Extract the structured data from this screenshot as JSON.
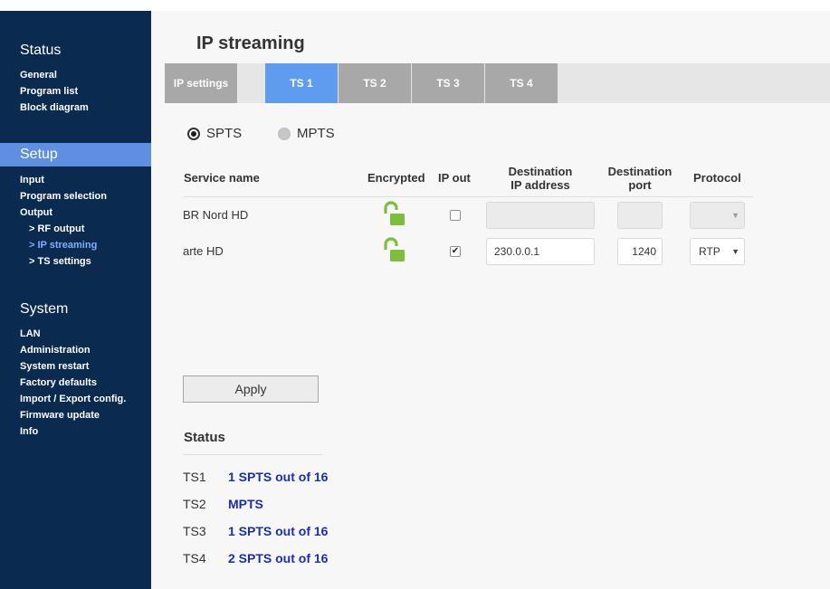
{
  "sidebar": {
    "status_title": "Status",
    "status_items": [
      "General",
      "Program list",
      "Block diagram"
    ],
    "setup_title": "Setup",
    "setup_items": [
      "Input",
      "Program selection",
      "Output",
      "> RF output",
      "> IP streaming",
      "> TS settings"
    ],
    "system_title": "System",
    "system_items": [
      "LAN",
      "Administration",
      "System restart",
      "Factory defaults",
      "Import / Export config.",
      "Firmware update",
      "Info"
    ]
  },
  "page": {
    "title": "IP streaming"
  },
  "tabs": [
    "IP settings",
    "TS 1",
    "TS 2",
    "TS 3",
    "TS 4"
  ],
  "active_tab": "TS 1",
  "mode": {
    "options": [
      "SPTS",
      "MPTS"
    ],
    "selected": "SPTS"
  },
  "table": {
    "headers": {
      "service": "Service name",
      "encrypted": "Encrypted",
      "ipout": "IP out",
      "dest_ip_1": "Destination",
      "dest_ip_2": "IP address",
      "dest_port_1": "Destination",
      "dest_port_2": "port",
      "protocol": "Protocol"
    },
    "rows": [
      {
        "service": "BR Nord HD",
        "encrypted": "unlocked-icon",
        "ip_out": false,
        "ip": "",
        "port": "",
        "protocol": ""
      },
      {
        "service": "arte HD",
        "encrypted": "unlocked-icon",
        "ip_out": true,
        "ip": "230.0.0.1",
        "port": "1240",
        "protocol": "RTP"
      }
    ]
  },
  "apply_label": "Apply",
  "status": {
    "title": "Status",
    "items": [
      {
        "label": "TS1",
        "value": "1 SPTS out of 16"
      },
      {
        "label": "TS2",
        "value": "MPTS"
      },
      {
        "label": "TS3",
        "value": "1 SPTS out of 16"
      },
      {
        "label": "TS4",
        "value": "2 SPTS out of 16"
      }
    ]
  },
  "colors": {
    "sidebar": "#0b2a4f",
    "accent": "#5f9cf0",
    "status_value": "#1a2fa8",
    "lock": "#7cbf3a"
  }
}
